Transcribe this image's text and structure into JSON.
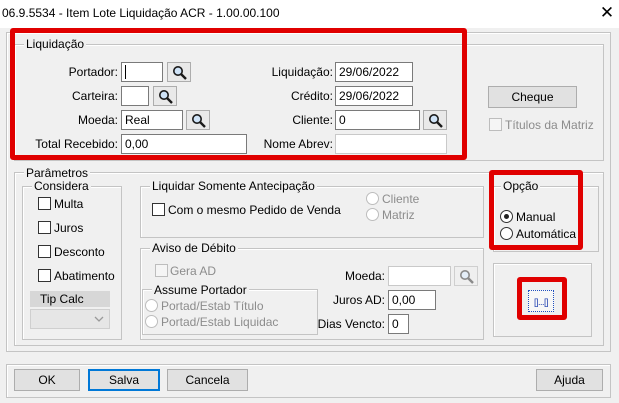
{
  "window": {
    "title": "06.9.5534 - Item Lote Liquidação ACR - 1.00.00.100",
    "close_glyph": "✕"
  },
  "liquidacao": {
    "legend": "Liquidação",
    "portador_label": "Portador:",
    "portador_value": "",
    "carteira_label": "Carteira:",
    "carteira_value": "",
    "moeda_label": "Moeda:",
    "moeda_value": "Real",
    "total_label": "Total Recebido:",
    "total_value": "0,00",
    "liquidacao_label": "Liquidação:",
    "liquidacao_value": "29/06/2022",
    "credito_label": "Crédito:",
    "credito_value": "29/06/2022",
    "cliente_label": "Cliente:",
    "cliente_value": "0",
    "nome_label": "Nome Abrev:",
    "nome_value": "",
    "cheque_label": "Cheque",
    "titulos_label": "Títulos da Matriz"
  },
  "parametros": {
    "legend": "Parâmetros",
    "considera": {
      "legend": "Considera",
      "items": [
        "Multa",
        "Juros",
        "Desconto",
        "Abatimento"
      ],
      "tipcalc_label": "Tip Calc"
    },
    "antecipacao": {
      "legend": "Liquidar Somente Antecipação",
      "pedido_label": "Com o mesmo Pedido de Venda",
      "cliente_label": "Cliente",
      "matriz_label": "Matriz"
    },
    "aviso": {
      "legend": "Aviso de Débito",
      "gera_label": "Gera AD",
      "assume_legend": "Assume Portador",
      "titulo_label": "Portad/Estab Título",
      "liquidac_label": "Portad/Estab Liquidac",
      "moeda_label": "Moeda:",
      "moeda_value": "",
      "juros_label": "Juros AD:",
      "juros_value": "0,00",
      "dias_label": "Dias Vencto:",
      "dias_value": "0"
    },
    "opcao": {
      "legend": "Opção",
      "manual_label": "Manual",
      "automatica_label": "Automática",
      "selected": "Manual"
    },
    "range_button_label": "[]...[]"
  },
  "footer": {
    "ok": "OK",
    "salva": "Salva",
    "cancela": "Cancela",
    "ajuda": "Ajuda"
  },
  "colors": {
    "highlight": "#e00000",
    "focus": "#0078d7"
  }
}
